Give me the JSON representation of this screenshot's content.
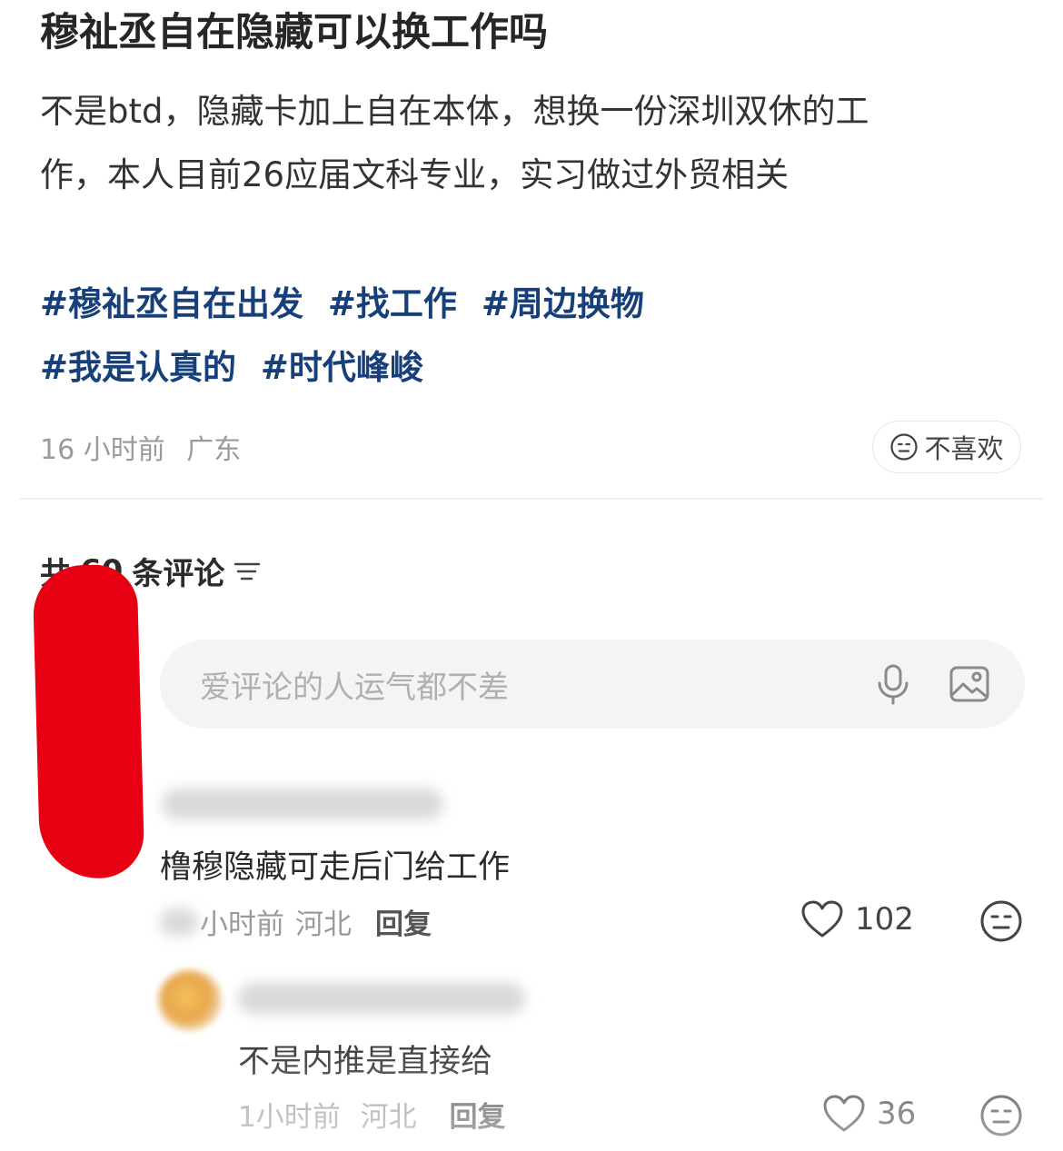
{
  "post": {
    "title": "穆祉丞自在隐藏可以换工作吗",
    "body_line1": "不是btd，隐藏卡加上自在本体，想换一份深圳双休的工",
    "body_line2": "作，本人目前26应届文科专业，实习做过外贸相关",
    "tags_row1": [
      "#穆祉丞自在出发",
      "#找工作",
      "#周边换物"
    ],
    "tags_row2": [
      "#我是认真的",
      "#时代峰峻"
    ],
    "time": "16 小时前",
    "location": "广东",
    "dislike_label": "不喜欢"
  },
  "comments_header": {
    "label_left": "共",
    "count": "60",
    "label_right": "条评论"
  },
  "comment_input": {
    "placeholder": "爱评论的人运气都不差"
  },
  "comments": [
    {
      "text": "橹穆隐藏可走后门给工作",
      "time": "小时前",
      "location": "河北",
      "reply_label": "回复",
      "likes": "102"
    },
    {
      "text": "不是内推是直接给",
      "time": "1小时前",
      "location": "河北",
      "reply_label": "回复",
      "likes": "36"
    }
  ],
  "colors": {
    "tag": "#173f7a",
    "redaction": "#e60012",
    "input_bg": "#f4f4f6"
  }
}
